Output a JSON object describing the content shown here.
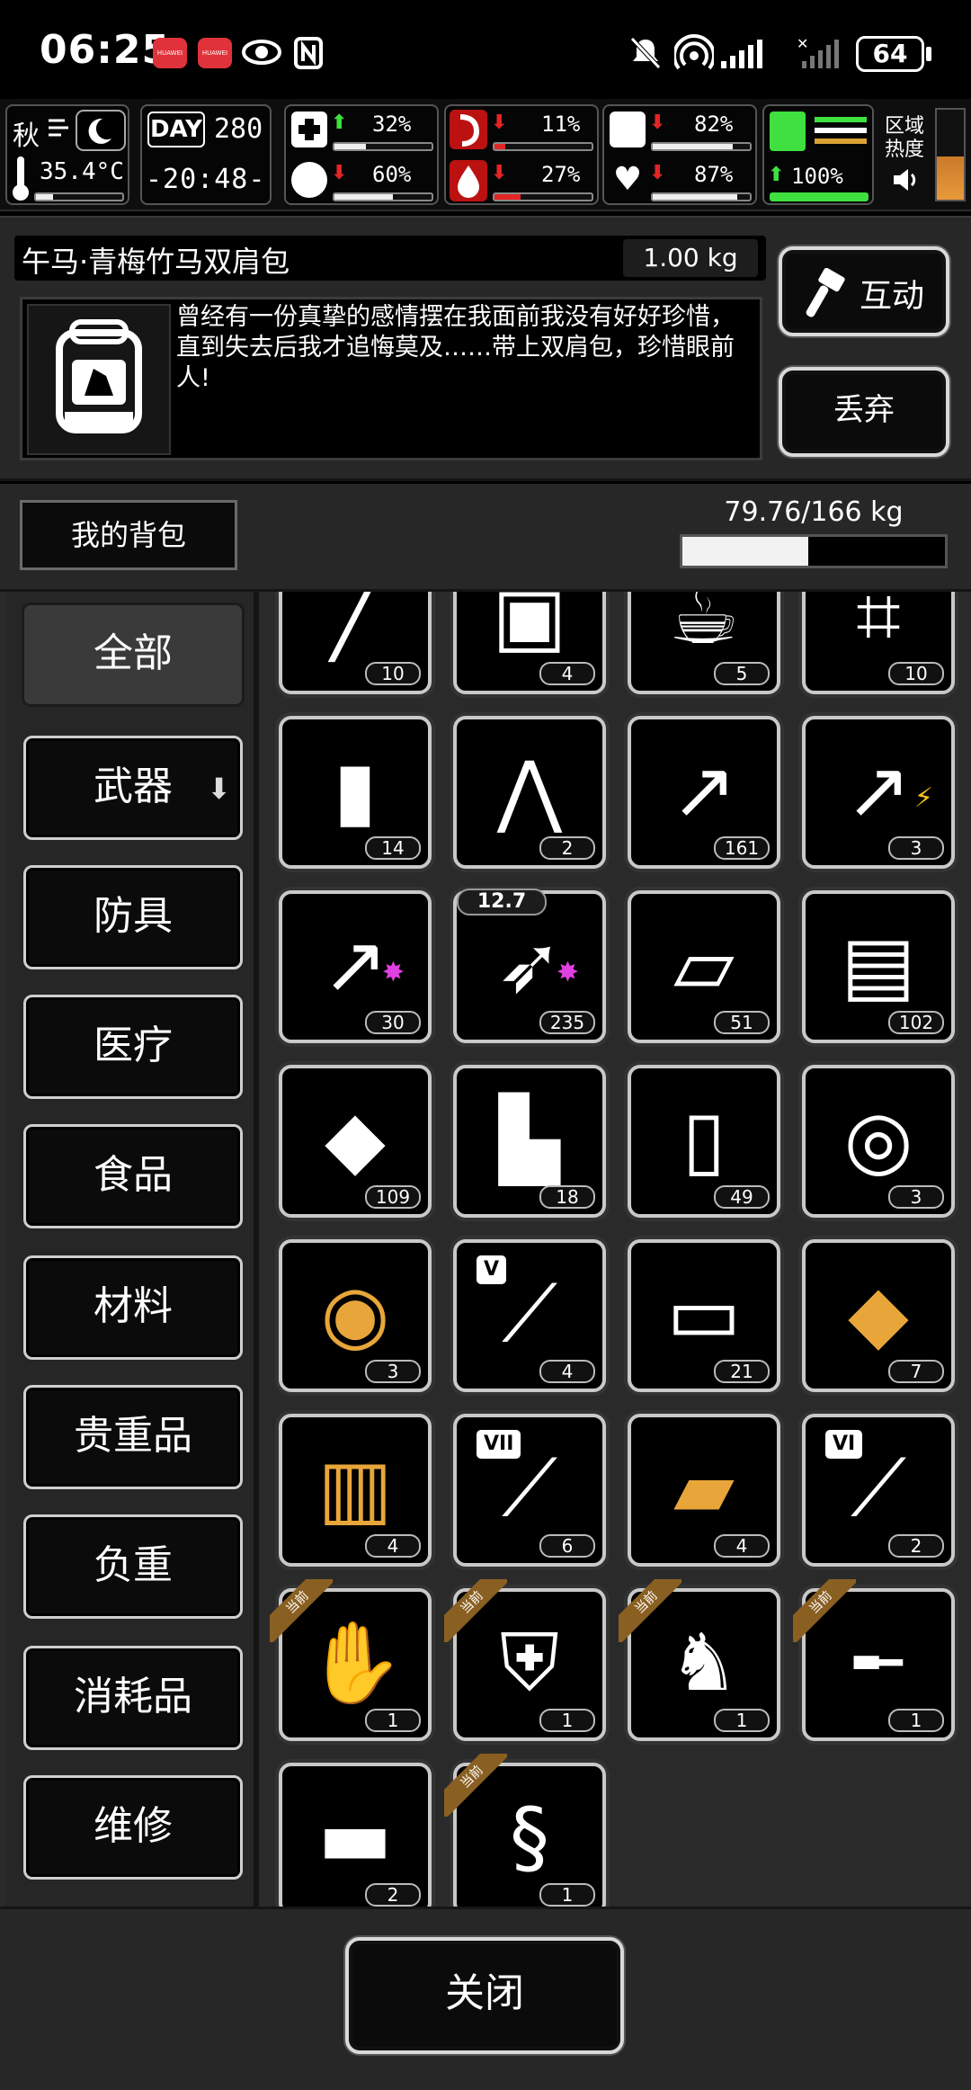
{
  "status_bar": {
    "time": "06:25",
    "app_icon_1": "HUAWEI",
    "app_icon_2": "HUAWEI",
    "battery": "64",
    "icons": [
      "eye-icon",
      "nfc-icon",
      "mute-icon",
      "hotspot-icon",
      "signal-icon",
      "no-signal-icon",
      "battery-icon"
    ]
  },
  "hud": {
    "season": "秋",
    "temperature": "35.4°C",
    "day_label": "DAY",
    "day": "280",
    "clock": "-20:48-",
    "health": "32%",
    "stamina": "60%",
    "hunger": "11%",
    "thirst": "27%",
    "energy": "82%",
    "mood": "87%",
    "speed": "100%",
    "zone_heat_label_1": "区域",
    "zone_heat_label_2": "热度",
    "colors": {
      "up": "#3fe03f",
      "down": "#e32525",
      "accent": "#d9a033"
    }
  },
  "item_detail": {
    "name": "午马·青梅竹马双肩包",
    "weight": "1.00 kg",
    "description": "曾经有一份真挚的感情摆在我面前我没有好好珍惜，直到失去后我才追悔莫及……带上双肩包，珍惜眼前人!",
    "interact_label": "互动",
    "discard_label": "丢弃"
  },
  "bag": {
    "tab_label": "我的背包",
    "capacity": "79.76/166 kg",
    "capacity_fraction": 0.48
  },
  "categories": [
    {
      "label": "全部",
      "active": true
    },
    {
      "label": "武器",
      "active": false,
      "has_arrow": true
    },
    {
      "label": "防具",
      "active": false
    },
    {
      "label": "医疗",
      "active": false
    },
    {
      "label": "食品",
      "active": false
    },
    {
      "label": "材料",
      "active": false
    },
    {
      "label": "贵重品",
      "active": false
    },
    {
      "label": "负重",
      "active": false
    },
    {
      "label": "消耗品",
      "active": false
    },
    {
      "label": "维修",
      "active": false
    }
  ],
  "items": [
    {
      "icon": "cigarette-icon",
      "count": "10"
    },
    {
      "icon": "toolkit-icon",
      "count": "4"
    },
    {
      "icon": "teacup-icon",
      "count": "5"
    },
    {
      "icon": "net-icon",
      "count": "10"
    },
    {
      "icon": "grenade-icon",
      "count": "14"
    },
    {
      "icon": "tweezers-icon",
      "count": "2"
    },
    {
      "icon": "arrow-icon",
      "count": "161"
    },
    {
      "icon": "electric-arrow-icon",
      "count": "3"
    },
    {
      "icon": "poison-arrow-icon",
      "count": "30"
    },
    {
      "icon": "bullet-icon",
      "count": "235",
      "caliber": "12.7"
    },
    {
      "icon": "cloth-icon",
      "count": "51"
    },
    {
      "icon": "folded-cloth-icon",
      "count": "102"
    },
    {
      "icon": "bag-of-powder-icon",
      "count": "109"
    },
    {
      "icon": "torn-shirt-icon",
      "count": "18"
    },
    {
      "icon": "paper-icon",
      "count": "49"
    },
    {
      "icon": "roll-icon",
      "count": "3"
    },
    {
      "icon": "gold-coil-icon",
      "count": "3"
    },
    {
      "icon": "test-tube-v-icon",
      "count": "4",
      "roman": "V"
    },
    {
      "icon": "towel-icon",
      "count": "21"
    },
    {
      "icon": "gold-crystal-icon",
      "count": "7"
    },
    {
      "icon": "gold-spool-icon",
      "count": "4"
    },
    {
      "icon": "test-tube-vii-icon",
      "count": "6",
      "roman": "VII"
    },
    {
      "icon": "gold-cloth-icon",
      "count": "4"
    },
    {
      "icon": "test-tube-vi-icon",
      "count": "2",
      "roman": "VI"
    },
    {
      "icon": "gloves-icon",
      "count": "1",
      "equipped": "当前"
    },
    {
      "icon": "armor-icon",
      "count": "1",
      "equipped": "当前"
    },
    {
      "icon": "horse-mask-icon",
      "count": "1",
      "equipped": "当前"
    },
    {
      "icon": "sniper-rifle-icon",
      "count": "1",
      "equipped": "当前"
    },
    {
      "icon": "bandage-icon",
      "count": "2"
    },
    {
      "icon": "scorpion-whip-icon",
      "count": "1",
      "equipped": "当前"
    }
  ],
  "close_label": "关闭"
}
